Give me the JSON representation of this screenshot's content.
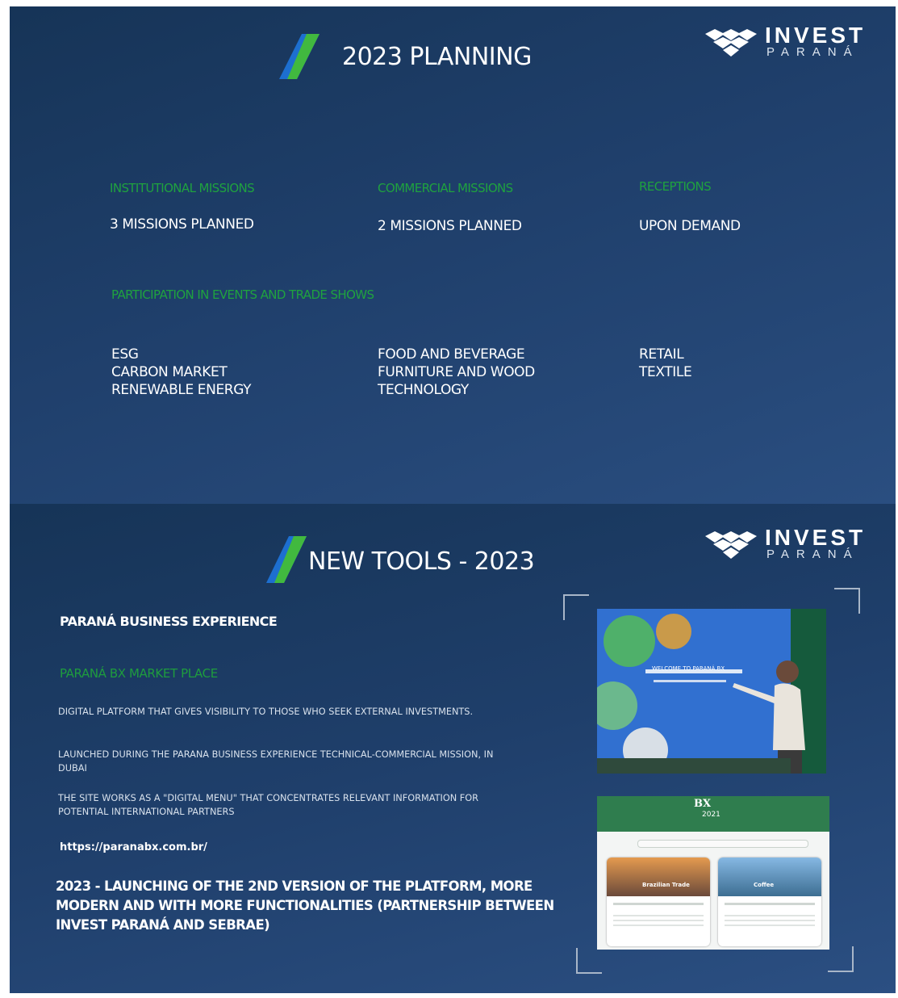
{
  "brand": {
    "name_top": "INVEST",
    "name_bottom": "PARANÁ"
  },
  "slide1": {
    "title": "2023 PLANNING",
    "columns": [
      {
        "heading": "INSTITUTIONAL MISSIONS",
        "value": "3 MISSIONS PLANNED"
      },
      {
        "heading": "COMMERCIAL MISSIONS",
        "value": "2 MISSIONS PLANNED"
      },
      {
        "heading": "RECEPTIONS",
        "value": "UPON DEMAND"
      }
    ],
    "events": {
      "heading": "PARTICIPATION IN EVENTS AND TRADE SHOWS",
      "col1": [
        "ESG",
        "CARBON MARKET",
        "RENEWABLE ENERGY"
      ],
      "col2": [
        "FOOD AND BEVERAGE",
        "FURNITURE AND WOOD",
        "TECHNOLOGY"
      ],
      "col3": [
        "RETAIL",
        "TEXTILE"
      ]
    }
  },
  "slide2": {
    "title": "NEW TOOLS - 2023",
    "section_title": "PARANÁ BUSINESS EXPERIENCE",
    "subtitle": "PARANÁ BX MARKET PLACE",
    "paragraphs": [
      "DIGITAL PLATFORM THAT GIVES VISIBILITY TO THOSE WHO SEEK EXTERNAL INVESTMENTS.",
      "LAUNCHED DURING THE PARANA BUSINESS EXPERIENCE TECHNICAL-COMMERCIAL MISSION, IN DUBAI",
      "THE SITE WORKS AS A \"DIGITAL MENU\" THAT CONCENTRATES RELEVANT INFORMATION FOR POTENTIAL INTERNATIONAL PARTNERS"
    ],
    "url": "https://paranabx.com.br/",
    "launch_text": "2023 - LAUNCHING OF THE 2ND VERSION OF THE PLATFORM, MORE MODERN AND WITH MORE FUNCTIONALITIES (PARTNERSHIP BETWEEN INVEST PARANÁ AND SEBRAE)",
    "screen_text": "WELCOME TO PARANÁ BX",
    "website": {
      "logo_top": "BX",
      "logo_bottom": "2021",
      "card1_title": "Brazilian Trade",
      "card2_title": "Coffee"
    }
  },
  "colors": {
    "heading_green": "#1fa23f",
    "background_blue": "#1f3f6b",
    "accent_blue": "#2f8fd6"
  }
}
